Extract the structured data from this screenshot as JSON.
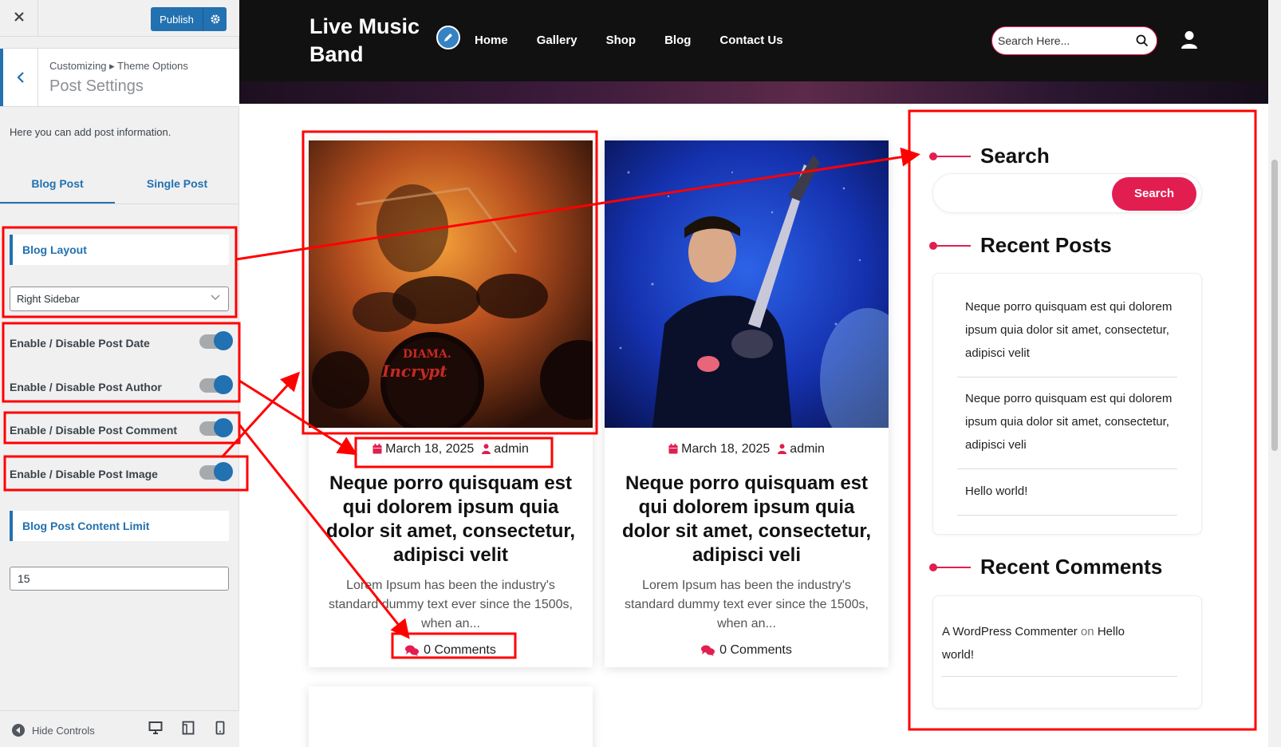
{
  "customizer": {
    "close_icon": "close-icon",
    "publish_label": "Publish",
    "breadcrumb": "Customizing ▸ Theme Options",
    "title": "Post Settings",
    "description": "Here you can add post information.",
    "tabs": [
      {
        "label": "Blog Post",
        "active": true
      },
      {
        "label": "Single Post",
        "active": false
      }
    ],
    "blog_layout": {
      "label": "Blog Layout",
      "selected": "Right Sidebar"
    },
    "toggles": [
      {
        "label": "Enable / Disable Post Date",
        "on": true
      },
      {
        "label": "Enable / Disable Post Author",
        "on": true
      },
      {
        "label": "Enable / Disable Post Comment",
        "on": true
      },
      {
        "label": "Enable / Disable Post Image",
        "on": true
      }
    ],
    "content_limit": {
      "label": "Blog Post Content Limit",
      "value": "15"
    },
    "footer": {
      "hide_label": "Hide Controls"
    }
  },
  "site": {
    "title": "Live Music Band",
    "nav": [
      "Home",
      "Gallery",
      "Shop",
      "Blog",
      "Contact Us"
    ],
    "search_placeholder": "Search Here...",
    "accent_color": "#e21e51"
  },
  "posts": [
    {
      "date": "March 18, 2025",
      "author": "admin",
      "title": "Neque porro quisquam est qui dolorem ipsum quia dolor sit amet, consectetur, adipisci velit",
      "excerpt": "Lorem Ipsum has been the industry's standard dummy text ever since the 1500s, when an...",
      "comments": "0 Comments"
    },
    {
      "date": "March 18, 2025",
      "author": "admin",
      "title": "Neque porro quisquam est qui dolorem ipsum quia dolor sit amet, consectetur, adipisci veli",
      "excerpt": "Lorem Ipsum has been the industry's standard dummy text ever since the 1500s, when an...",
      "comments": "0 Comments"
    }
  ],
  "sidebar": {
    "search": {
      "title": "Search",
      "button": "Search"
    },
    "recent_posts": {
      "title": "Recent Posts",
      "items": [
        "Neque porro quisquam est qui dolorem ipsum quia dolor sit amet, consectetur, adipisci velit",
        "Neque porro quisquam est qui dolorem ipsum quia dolor sit amet, consectetur, adipisci veli",
        "Hello world!"
      ]
    },
    "recent_comments": {
      "title": "Recent Comments",
      "author": "A WordPress Commenter",
      "on": "on",
      "post": "Hello world!"
    }
  }
}
